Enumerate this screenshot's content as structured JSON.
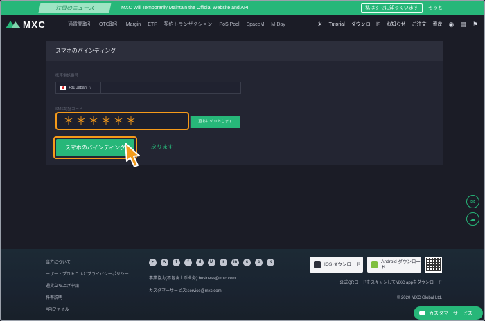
{
  "notice": {
    "tag": "注目のニュース",
    "text": "MXC Will Temporarily Maintain the Official Website and API",
    "button": "私はすでに知っています",
    "more": "もっと"
  },
  "nav": {
    "logo": "MXC",
    "items": [
      "通貨間取引",
      "OTC取引",
      "Margin",
      "ETF",
      "契約トランザクション",
      "PoS Pool",
      "SpaceM",
      "M-Day"
    ],
    "tutorial": "Tutorial",
    "download": "ダウンロード",
    "notifications": "お知らせ",
    "orders": "ご注文",
    "assets": "資産"
  },
  "card": {
    "title": "スマホのバインディング",
    "phone_label": "携帯電話番号",
    "country": "+81 Japan",
    "country_caret": "∨",
    "code_label": "SMS認証コード",
    "code_value": "＊＊＊＊＊＊",
    "get_code": "直ちにゲットします",
    "bind_button": "スマホのバインディング",
    "back": "戻ります"
  },
  "footer": {
    "links": [
      "当方について",
      "ーザー・プロトコルとプライバシーポリシー",
      "通貨立ち上げ申請",
      "料率説明",
      "APIファイル"
    ],
    "business": "事業協力(不包含上币业务):business@mxc.com",
    "service": "カスタマーサービス:service@mxc.com",
    "ios": "IOS ダウンロード",
    "android": "Android ダウンロード",
    "qr_note": "公式QRコードをスキャンしてMXC appをダウンロード",
    "copyright": "© 2020 MXC Global Ltd."
  },
  "chat": {
    "label": "カスタマーサービス"
  },
  "colors": {
    "accent": "#27b779",
    "highlight": "#f59a1a",
    "background": "#1b1c26"
  }
}
